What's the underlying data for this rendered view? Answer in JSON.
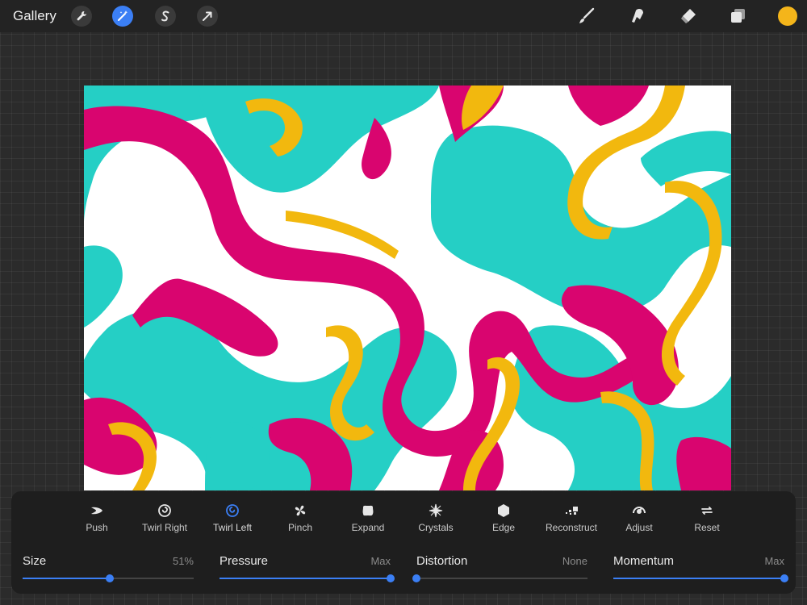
{
  "topbar": {
    "gallery_label": "Gallery",
    "left_tools": [
      "wrench-icon",
      "magic-wand-icon",
      "selection-s-icon",
      "transform-arrow-icon"
    ],
    "active_tool": "magic-wand-icon",
    "right_tools": [
      "brush-icon",
      "smudge-icon",
      "eraser-icon",
      "layers-icon"
    ],
    "current_color": "#F4B51A"
  },
  "canvas": {
    "colors": {
      "teal": "#25CFC5",
      "magenta": "#D9056F",
      "yellow": "#F2B80E",
      "white": "#FFFFFF"
    }
  },
  "liquify": {
    "modes": [
      {
        "label": "Push",
        "icon": "push-icon",
        "active": false
      },
      {
        "label": "Twirl Right",
        "icon": "twirl-right-icon",
        "active": false
      },
      {
        "label": "Twirl Left",
        "icon": "twirl-left-icon",
        "active": true
      },
      {
        "label": "Pinch",
        "icon": "pinch-icon",
        "active": false
      },
      {
        "label": "Expand",
        "icon": "expand-icon",
        "active": false
      },
      {
        "label": "Crystals",
        "icon": "crystals-icon",
        "active": false
      },
      {
        "label": "Edge",
        "icon": "edge-icon",
        "active": false
      },
      {
        "label": "Reconstruct",
        "icon": "reconstruct-icon",
        "active": false
      },
      {
        "label": "Adjust",
        "icon": "adjust-icon",
        "active": false
      },
      {
        "label": "Reset",
        "icon": "reset-icon",
        "active": false
      }
    ],
    "sliders": [
      {
        "name": "Size",
        "value_text": "51%",
        "level": 0.51
      },
      {
        "name": "Pressure",
        "value_text": "Max",
        "level": 1.0
      },
      {
        "name": "Distortion",
        "value_text": "None",
        "level": 0.0
      },
      {
        "name": "Momentum",
        "value_text": "Max",
        "level": 1.0
      }
    ],
    "accent": "#3B7FF5"
  }
}
